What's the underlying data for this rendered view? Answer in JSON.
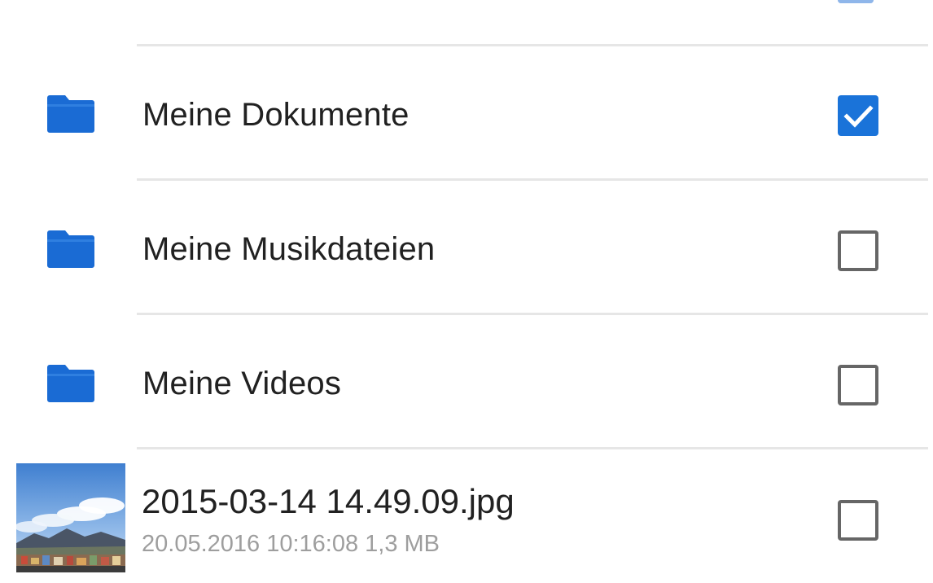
{
  "folders": [
    {
      "label": "Meine Dokumente",
      "checked": true
    },
    {
      "label": "Meine Musikdateien",
      "checked": false
    },
    {
      "label": "Meine Videos",
      "checked": false
    }
  ],
  "file": {
    "name": "2015-03-14 14.49.09.jpg",
    "meta": "20.05.2016 10:16:08 1,3 MB",
    "checked": false
  },
  "colors": {
    "accent": "#1a73d9",
    "folder": "#1a6bd4",
    "text": "#212121",
    "secondary_text": "#9e9e9e",
    "divider": "#e6e6e6"
  },
  "icons": {
    "folder": "folder-icon",
    "checkmark": "checkmark-icon"
  }
}
